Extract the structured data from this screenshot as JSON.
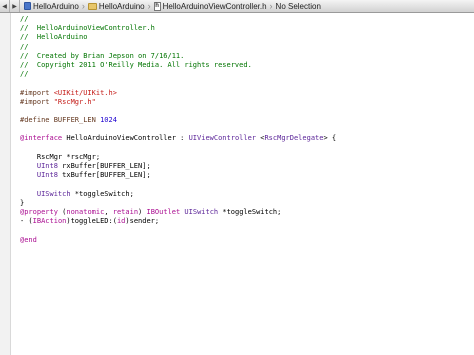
{
  "jumpbar": {
    "back_glyph": "◀",
    "forward_glyph": "▶",
    "crumbs": [
      "HelloArduino",
      "HelloArduino",
      "HelloArduinoViewController.h",
      "No Selection"
    ],
    "file_icon_glyph": "h",
    "separator": "›"
  },
  "colors": {
    "comment": "#007400",
    "keyword": "#aa0d91",
    "preprocessor": "#643820",
    "string": "#c41a16",
    "class": "#5c2699",
    "number": "#1c00cf",
    "text": "#000000"
  },
  "code": [
    [
      [
        "//",
        "c"
      ]
    ],
    [
      [
        "//  HelloArduinoViewController.h",
        "c"
      ]
    ],
    [
      [
        "//  HelloArduino",
        "c"
      ]
    ],
    [
      [
        "//",
        "c"
      ]
    ],
    [
      [
        "//  Created by Brian Jepson on 7/16/11.",
        "c"
      ]
    ],
    [
      [
        "//  Copyright 2011 O'Reilly Media. All rights reserved.",
        "c"
      ]
    ],
    [
      [
        "//",
        "c"
      ]
    ],
    [],
    [
      [
        "#import ",
        "p"
      ],
      [
        "<UIKit/UIKit.h>",
        "s"
      ]
    ],
    [
      [
        "#import ",
        "p"
      ],
      [
        "\"RscMgr.h\"",
        "s"
      ]
    ],
    [],
    [
      [
        "#define BUFFER_LEN ",
        "p"
      ],
      [
        "1024",
        "n"
      ]
    ],
    [],
    [
      [
        "@interface",
        "k"
      ],
      [
        " HelloArduinoViewController : ",
        "t"
      ],
      [
        "UIViewController",
        "x"
      ],
      [
        " <",
        "t"
      ],
      [
        "RscMgrDelegate",
        "x"
      ],
      [
        "> {",
        "t"
      ]
    ],
    [],
    [
      [
        "    RscMgr *rscMgr;",
        "t"
      ]
    ],
    [
      [
        "    ",
        "t"
      ],
      [
        "UInt8",
        "x"
      ],
      [
        " rxBuffer[BUFFER_LEN];",
        "t"
      ]
    ],
    [
      [
        "    ",
        "t"
      ],
      [
        "UInt8",
        "x"
      ],
      [
        " txBuffer[BUFFER_LEN];",
        "t"
      ]
    ],
    [],
    [
      [
        "    ",
        "t"
      ],
      [
        "UISwitch",
        "x"
      ],
      [
        " *toggleSwitch;",
        "t"
      ]
    ],
    [
      [
        "}",
        "t"
      ]
    ],
    [
      [
        "@property",
        "k"
      ],
      [
        " (",
        "t"
      ],
      [
        "nonatomic",
        "k"
      ],
      [
        ", ",
        "t"
      ],
      [
        "retain",
        "k"
      ],
      [
        ") ",
        "t"
      ],
      [
        "IBOutlet",
        "k"
      ],
      [
        " ",
        "t"
      ],
      [
        "UISwitch",
        "x"
      ],
      [
        " *toggleSwitch;",
        "t"
      ]
    ],
    [
      [
        "- (",
        "t"
      ],
      [
        "IBAction",
        "k"
      ],
      [
        ")toggleLED:(",
        "t"
      ],
      [
        "id",
        "k"
      ],
      [
        ")sender;",
        "t"
      ]
    ],
    [],
    [
      [
        "@end",
        "k"
      ]
    ]
  ]
}
